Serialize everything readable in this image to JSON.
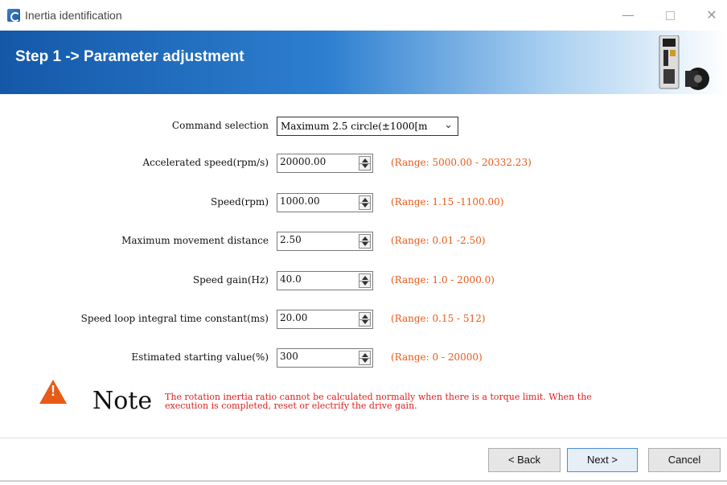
{
  "window": {
    "title": "Inertia identification",
    "controls": {
      "minimize": "—",
      "close": "✕"
    }
  },
  "header": {
    "title": "Step 1 -> Parameter adjustment"
  },
  "form": {
    "command": {
      "label": "Command selection",
      "value": "Maximum 2.5 circle(±1000[m"
    },
    "accel": {
      "label": "Accelerated speed(rpm/s)",
      "value": "20000.00",
      "range": "(Range: 5000.00 - 20332.23)"
    },
    "speed": {
      "label": "Speed(rpm)",
      "value": "1000.00",
      "range": "(Range: 1.15 -1100.00)"
    },
    "distance": {
      "label": "Maximum movement distance",
      "value": "2.50",
      "range": "(Range: 0.01 -2.50)"
    },
    "gain": {
      "label": "Speed gain(Hz)",
      "value": "40.0",
      "range": "(Range: 1.0 - 2000.0)"
    },
    "integral": {
      "label": "Speed loop integral time constant(ms)",
      "value": "20.00",
      "range": "(Range: 0.15 - 512)"
    },
    "estimate": {
      "label": "Estimated starting value(%)",
      "value": "300",
      "range": "(Range: 0 - 20000)"
    }
  },
  "note": {
    "title": "Note",
    "text": "The rotation inertia ratio cannot be calculated normally when there is a torque limit. When the execution is completed, reset or electrify the drive gain."
  },
  "footer": {
    "back": "< Back",
    "next": "Next >",
    "cancel": "Cancel"
  },
  "colors": {
    "banner_start": "#1558a8",
    "range_text": "#e85a18",
    "note_text": "#e02020",
    "warning_icon": "#e85a18"
  },
  "icons": [
    "app-icon",
    "minimize-icon",
    "maximize-icon",
    "close-icon",
    "servo-drive-icon",
    "chevron-down-icon",
    "spin-up-icon",
    "spin-down-icon",
    "warning-icon"
  ]
}
